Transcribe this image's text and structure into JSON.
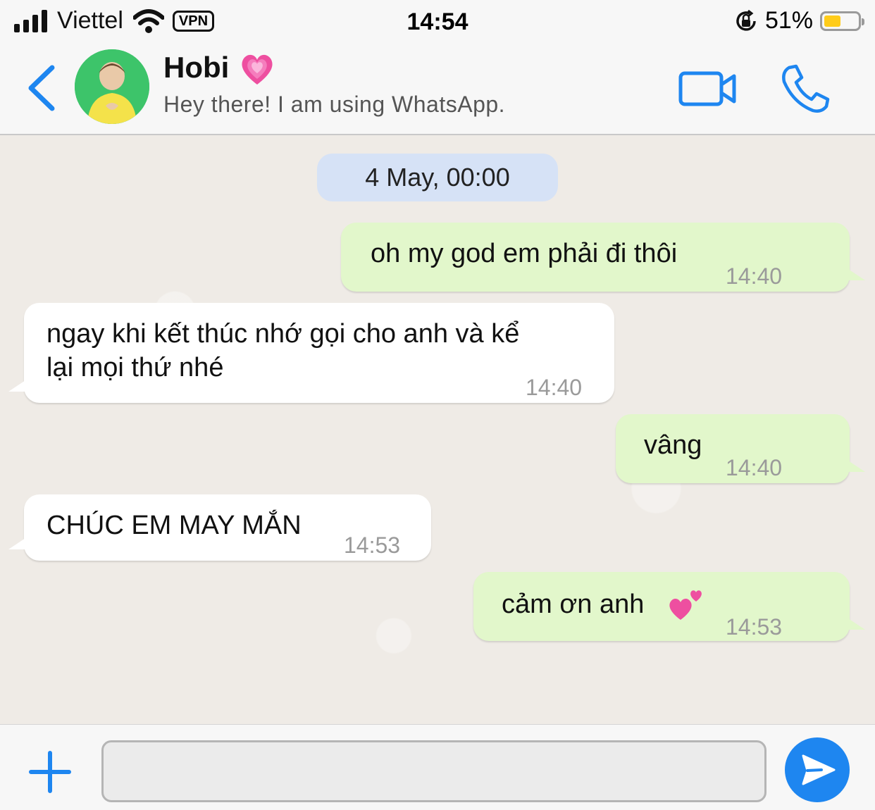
{
  "status_bar": {
    "carrier": "Viettel",
    "vpn_label": "VPN",
    "time": "14:54",
    "battery_percent": "51%",
    "battery_level": 0.51,
    "signal_bars": 4
  },
  "header": {
    "contact_name": "Hobi",
    "contact_status": "Hey there! I am using WhatsApp.",
    "name_emoji": "growing-heart-emoji"
  },
  "chat": {
    "date_label": "4 May, 00:00",
    "messages": [
      {
        "direction": "out",
        "text": "oh my god em phải đi thôi",
        "time": "14:40"
      },
      {
        "direction": "in",
        "text_line1": "ngay khi kết thúc nhớ gọi cho anh và kể",
        "text_line2": "lại mọi thứ nhé",
        "time": "14:40"
      },
      {
        "direction": "out",
        "text": "vâng",
        "time": "14:40"
      },
      {
        "direction": "in",
        "text": "CHÚC EM MAY MẮN",
        "time": "14:53"
      },
      {
        "direction": "out",
        "text": "cảm ơn anh",
        "emoji": "two-hearts-emoji",
        "time": "14:53"
      }
    ]
  },
  "input_bar": {
    "placeholder": ""
  },
  "colors": {
    "accent": "#1e86f0",
    "outgoing_bubble": "#e2f7cb",
    "incoming_bubble": "#ffffff",
    "date_pill": "#d6e2f6"
  }
}
